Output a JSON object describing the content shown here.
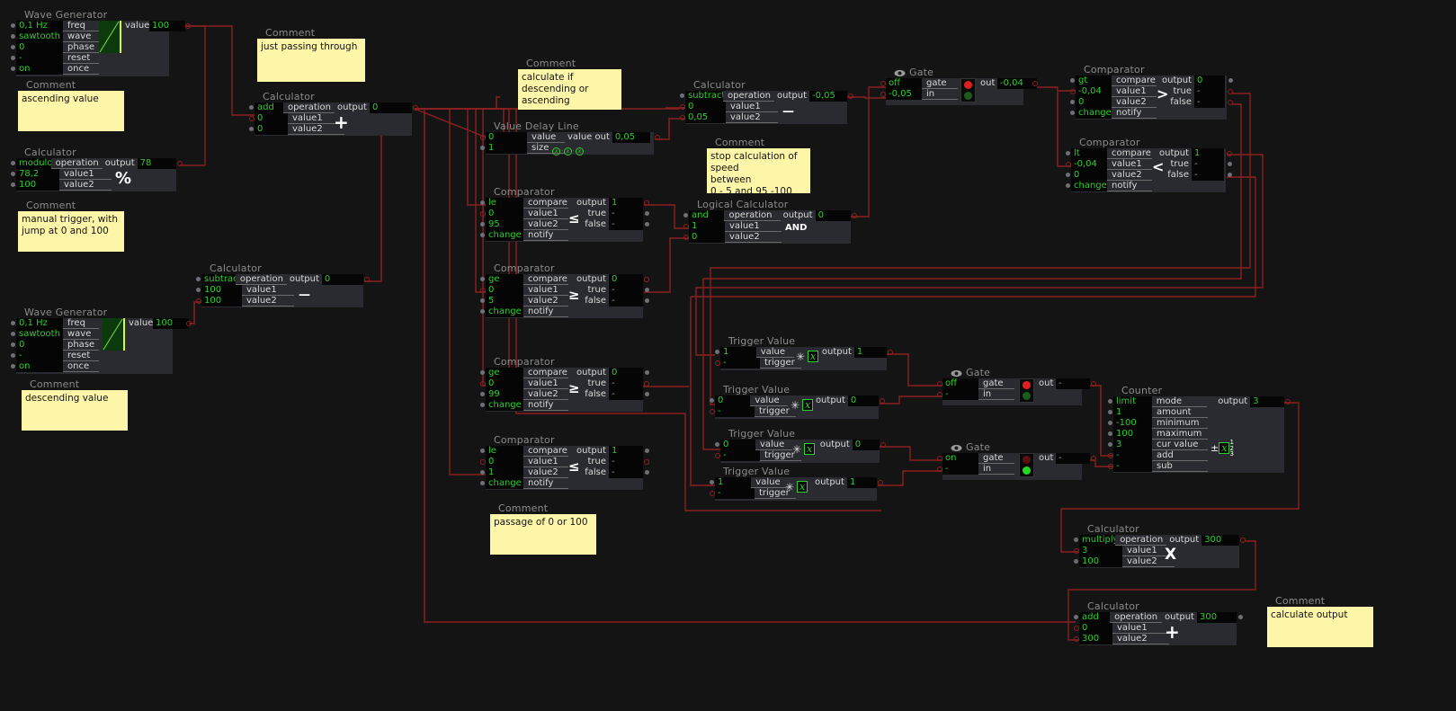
{
  "app": {
    "background": "#141414",
    "wire_color": "#8c2020",
    "value_color": "#2ecc2e",
    "comment_color": "#fdf6a8"
  },
  "nodes": [
    {
      "id": "wavegen1",
      "type": "Wave Generator",
      "title": "Wave Generator",
      "inputs": [
        {
          "value": "0,1 Hz",
          "label": "freq"
        },
        {
          "value": "sawtooth",
          "label": "wave"
        },
        {
          "value": "0",
          "label": "phase"
        },
        {
          "value": "-",
          "label": "reset"
        },
        {
          "value": "on",
          "label": "once"
        }
      ],
      "outputs": [
        {
          "label": "value",
          "value": "100"
        }
      ]
    },
    {
      "id": "comment-ascending",
      "type": "Comment",
      "title": "Comment",
      "text": "ascending value"
    },
    {
      "id": "calc-modulo",
      "type": "Calculator",
      "title": "Calculator",
      "op_glyph": "%",
      "inputs": [
        {
          "value": "modulo",
          "label": "operation"
        },
        {
          "value": "78,2",
          "label": "value1"
        },
        {
          "value": "100",
          "label": "value2"
        }
      ],
      "outputs": [
        {
          "label": "output",
          "value": "78"
        }
      ]
    },
    {
      "id": "comment-manual",
      "type": "Comment",
      "title": "Comment",
      "text": "manual trigger, with\njump at 0 and 100"
    },
    {
      "id": "wavegen2",
      "type": "Wave Generator",
      "title": "Wave Generator",
      "inputs": [
        {
          "value": "0,1 Hz",
          "label": "freq"
        },
        {
          "value": "sawtooth",
          "label": "wave"
        },
        {
          "value": "0",
          "label": "phase"
        },
        {
          "value": "-",
          "label": "reset"
        },
        {
          "value": "on",
          "label": "once"
        }
      ],
      "outputs": [
        {
          "label": "value",
          "value": "100"
        }
      ]
    },
    {
      "id": "comment-descending",
      "type": "Comment",
      "title": "Comment",
      "text": "descending value"
    },
    {
      "id": "calc-sub-100",
      "type": "Calculator",
      "title": "Calculator",
      "op_glyph": "—",
      "inputs": [
        {
          "value": "subtract",
          "label": "operation"
        },
        {
          "value": "100",
          "label": "value1"
        },
        {
          "value": "100",
          "label": "value2"
        }
      ],
      "outputs": [
        {
          "label": "output",
          "value": "0"
        }
      ]
    },
    {
      "id": "comment-passing",
      "type": "Comment",
      "title": "Comment",
      "text": "just passing through"
    },
    {
      "id": "calc-add-main",
      "type": "Calculator",
      "title": "Calculator",
      "op_glyph": "+",
      "inputs": [
        {
          "value": "add",
          "label": "operation"
        },
        {
          "value": "0",
          "label": "value1"
        },
        {
          "value": "0",
          "label": "value2"
        }
      ],
      "outputs": [
        {
          "label": "output",
          "value": "0"
        }
      ]
    },
    {
      "id": "comment-descasc",
      "type": "Comment",
      "title": "Comment",
      "text": "calculate if descending or\nascending"
    },
    {
      "id": "delayline",
      "type": "Value Delay Line",
      "title": "Value Delay Line",
      "inputs": [
        {
          "value": "0",
          "label": "value"
        },
        {
          "value": "1",
          "label": "size"
        }
      ],
      "outputs": [
        {
          "label": "value out",
          "value": "0,05"
        }
      ]
    },
    {
      "id": "cmp-le-95",
      "type": "Comparator",
      "title": "Comparator",
      "op_glyph": "≤",
      "inputs": [
        {
          "value": "le",
          "label": "compare"
        },
        {
          "value": "0",
          "label": "value1"
        },
        {
          "value": "95",
          "label": "value2"
        },
        {
          "value": "change",
          "label": "notify"
        }
      ],
      "outputs": [
        {
          "label": "output",
          "value": "1"
        },
        {
          "label": "true",
          "value": "-"
        },
        {
          "label": "false",
          "value": "-"
        }
      ]
    },
    {
      "id": "cmp-ge-5",
      "type": "Comparator",
      "title": "Comparator",
      "op_glyph": "≥",
      "inputs": [
        {
          "value": "ge",
          "label": "compare"
        },
        {
          "value": "0",
          "label": "value1"
        },
        {
          "value": "5",
          "label": "value2"
        },
        {
          "value": "change",
          "label": "notify"
        }
      ],
      "outputs": [
        {
          "label": "output",
          "value": "0"
        },
        {
          "label": "true",
          "value": "-"
        },
        {
          "label": "false",
          "value": "-"
        }
      ]
    },
    {
      "id": "cmp-ge-99",
      "type": "Comparator",
      "title": "Comparator",
      "op_glyph": "≥",
      "inputs": [
        {
          "value": "ge",
          "label": "compare"
        },
        {
          "value": "0",
          "label": "value1"
        },
        {
          "value": "99",
          "label": "value2"
        },
        {
          "value": "change",
          "label": "notify"
        }
      ],
      "outputs": [
        {
          "label": "output",
          "value": "0"
        },
        {
          "label": "true",
          "value": "-"
        },
        {
          "label": "false",
          "value": "-"
        }
      ]
    },
    {
      "id": "cmp-le-1",
      "type": "Comparator",
      "title": "Comparator",
      "op_glyph": "≤",
      "inputs": [
        {
          "value": "le",
          "label": "compare"
        },
        {
          "value": "0",
          "label": "value1"
        },
        {
          "value": "1",
          "label": "value2"
        },
        {
          "value": "change",
          "label": "notify"
        }
      ],
      "outputs": [
        {
          "label": "output",
          "value": "1"
        },
        {
          "label": "true",
          "value": "-"
        },
        {
          "label": "false",
          "value": "-"
        }
      ]
    },
    {
      "id": "comment-passage",
      "type": "Comment",
      "title": "Comment",
      "text": "passage of 0 or 100"
    },
    {
      "id": "calc-sub-speed",
      "type": "Calculator",
      "title": "Calculator",
      "op_glyph": "—",
      "inputs": [
        {
          "value": "subtract",
          "label": "operation"
        },
        {
          "value": "0",
          "label": "value1"
        },
        {
          "value": "0,05",
          "label": "value2"
        }
      ],
      "outputs": [
        {
          "label": "output",
          "value": "-0,05"
        }
      ]
    },
    {
      "id": "comment-stopspeed",
      "type": "Comment",
      "title": "Comment",
      "text": "stop calculation of speed\nbetween\n0 - 5 and 95 -100"
    },
    {
      "id": "logical-and",
      "type": "Logical Calculator",
      "title": "Logical Calculator",
      "op_glyph": "AND",
      "inputs": [
        {
          "value": "and",
          "label": "operation"
        },
        {
          "value": "1",
          "label": "value1"
        },
        {
          "value": "0",
          "label": "value2"
        }
      ],
      "outputs": [
        {
          "label": "output",
          "value": "0"
        }
      ]
    },
    {
      "id": "gate-speed",
      "type": "Gate",
      "title": "Gate",
      "light": "red",
      "inputs": [
        {
          "value": "off",
          "label": "gate"
        },
        {
          "value": "-0,05",
          "label": "in"
        }
      ],
      "outputs": [
        {
          "label": "out",
          "value": "-0,04"
        }
      ]
    },
    {
      "id": "cmp-gt-0",
      "type": "Comparator",
      "title": "Comparator",
      "op_glyph": ">",
      "inputs": [
        {
          "value": "gt",
          "label": "compare"
        },
        {
          "value": "-0,04",
          "label": "value1"
        },
        {
          "value": "0",
          "label": "value2"
        },
        {
          "value": "change",
          "label": "notify"
        }
      ],
      "outputs": [
        {
          "label": "output",
          "value": "0"
        },
        {
          "label": "true",
          "value": "-"
        },
        {
          "label": "false",
          "value": "-"
        }
      ]
    },
    {
      "id": "cmp-lt-0",
      "type": "Comparator",
      "title": "Comparator",
      "op_glyph": "<",
      "inputs": [
        {
          "value": "lt",
          "label": "compare"
        },
        {
          "value": "-0,04",
          "label": "value1"
        },
        {
          "value": "0",
          "label": "value2"
        },
        {
          "value": "change",
          "label": "notify"
        }
      ],
      "outputs": [
        {
          "label": "output",
          "value": "1"
        },
        {
          "label": "true",
          "value": "-"
        },
        {
          "label": "false",
          "value": "-"
        }
      ]
    },
    {
      "id": "trig1",
      "type": "Trigger Value",
      "title": "Trigger Value",
      "inputs": [
        {
          "value": "1",
          "label": "value"
        },
        {
          "value": "-",
          "label": "trigger"
        }
      ],
      "outputs": [
        {
          "label": "output",
          "value": "1"
        }
      ]
    },
    {
      "id": "trig2",
      "type": "Trigger Value",
      "title": "Trigger Value",
      "inputs": [
        {
          "value": "0",
          "label": "value"
        },
        {
          "value": "-",
          "label": "trigger"
        }
      ],
      "outputs": [
        {
          "label": "output",
          "value": "0"
        }
      ]
    },
    {
      "id": "trig3",
      "type": "Trigger Value",
      "title": "Trigger Value",
      "inputs": [
        {
          "value": "0",
          "label": "value"
        },
        {
          "value": "-",
          "label": "trigger"
        }
      ],
      "outputs": [
        {
          "label": "output",
          "value": "0"
        }
      ]
    },
    {
      "id": "trig4",
      "type": "Trigger Value",
      "title": "Trigger Value",
      "inputs": [
        {
          "value": "1",
          "label": "value"
        },
        {
          "value": "-",
          "label": "trigger"
        }
      ],
      "outputs": [
        {
          "label": "output",
          "value": "1"
        }
      ]
    },
    {
      "id": "gate-add",
      "type": "Gate",
      "title": "Gate",
      "light": "red",
      "inputs": [
        {
          "value": "off",
          "label": "gate"
        },
        {
          "value": "-",
          "label": "in"
        }
      ],
      "outputs": [
        {
          "label": "out",
          "value": "-"
        }
      ]
    },
    {
      "id": "gate-sub",
      "type": "Gate",
      "title": "Gate",
      "light": "green",
      "inputs": [
        {
          "value": "on",
          "label": "gate"
        },
        {
          "value": "-",
          "label": "in"
        }
      ],
      "outputs": [
        {
          "label": "out",
          "value": "-"
        }
      ]
    },
    {
      "id": "counter",
      "type": "Counter",
      "title": "Counter",
      "inputs": [
        {
          "value": "limit",
          "label": "mode"
        },
        {
          "value": "1",
          "label": "amount"
        },
        {
          "value": "-100",
          "label": "minimum"
        },
        {
          "value": "100",
          "label": "maximum"
        },
        {
          "value": "3",
          "label": "cur value"
        },
        {
          "value": "-",
          "label": "add"
        },
        {
          "value": "-",
          "label": "sub"
        }
      ],
      "outputs": [
        {
          "label": "output",
          "value": "3"
        }
      ]
    },
    {
      "id": "calc-multiply",
      "type": "Calculator",
      "title": "Calculator",
      "op_glyph": "X",
      "inputs": [
        {
          "value": "multiply",
          "label": "operation"
        },
        {
          "value": "3",
          "label": "value1"
        },
        {
          "value": "100",
          "label": "value2"
        }
      ],
      "outputs": [
        {
          "label": "output",
          "value": "300"
        }
      ]
    },
    {
      "id": "calc-add-final",
      "type": "Calculator",
      "title": "Calculator",
      "op_glyph": "+",
      "inputs": [
        {
          "value": "add",
          "label": "operation"
        },
        {
          "value": "0",
          "label": "value1"
        },
        {
          "value": "300",
          "label": "value2"
        }
      ],
      "outputs": [
        {
          "label": "output",
          "value": "300"
        }
      ]
    },
    {
      "id": "comment-output",
      "type": "Comment",
      "title": "Comment",
      "text": "calculate output"
    }
  ]
}
